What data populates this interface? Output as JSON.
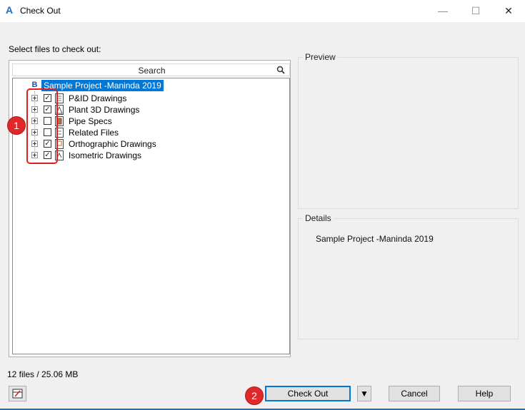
{
  "window": {
    "title": "Check Out",
    "app_icon": "autocad-A-icon",
    "minimize": "—",
    "maximize": "☐",
    "close": "✕"
  },
  "tree_panel": {
    "label": "Select files to check out:",
    "search_placeholder": "Search",
    "root": {
      "badge": "B",
      "label": "Sample Project -Maninda 2019"
    },
    "items": [
      {
        "label": "P&ID Drawings",
        "checked": true,
        "check": "✓"
      },
      {
        "label": "Plant 3D Drawings",
        "checked": true,
        "check": "✓"
      },
      {
        "label": "Pipe Specs",
        "checked": false,
        "check": ""
      },
      {
        "label": "Related Files",
        "checked": false,
        "check": ""
      },
      {
        "label": "Orthographic Drawings",
        "checked": true,
        "check": "✓"
      },
      {
        "label": "Isometric Drawings",
        "checked": true,
        "check": "✓"
      }
    ]
  },
  "preview": {
    "title": "Preview"
  },
  "details": {
    "title": "Details",
    "text": "Sample Project -Maninda 2019"
  },
  "status": {
    "text": "12 files / 25.06 MB"
  },
  "buttons": {
    "check_out": "Check Out",
    "dropdown": "▼",
    "cancel": "Cancel",
    "help": "Help"
  },
  "annotations": {
    "badge1": "1",
    "badge2": "2"
  },
  "colors": {
    "accent": "#0078d7",
    "annotation": "#e01e1e"
  }
}
